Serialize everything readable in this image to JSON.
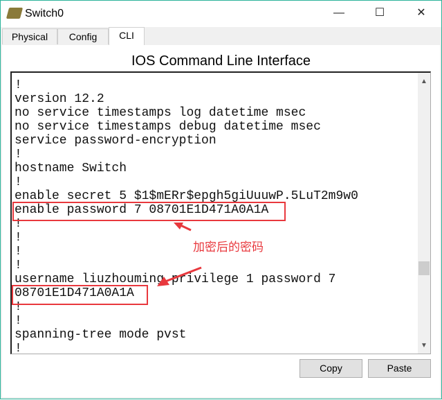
{
  "window": {
    "title": "Switch0",
    "minimize": "—",
    "maximize": "☐",
    "close": "✕",
    "icon": "switch-icon"
  },
  "tabs": [
    {
      "label": "Physical"
    },
    {
      "label": "Config"
    },
    {
      "label": "CLI",
      "active": true
    }
  ],
  "heading": "IOS Command Line Interface",
  "terminal": {
    "lines": [
      "!",
      "version 12.2",
      "no service timestamps log datetime msec",
      "no service timestamps debug datetime msec",
      "service password-encryption",
      "!",
      "hostname Switch",
      "!",
      "enable secret 5 $1$mERr$epgh5giUuuwP.5LuT2m9w0",
      "enable password 7 08701E1D471A0A1A",
      "!",
      "!",
      "!",
      "!",
      "username liuzhouming privilege 1 password 7",
      "08701E1D471A0A1A",
      "!",
      "!",
      "spanning-tree mode pvst",
      "!"
    ]
  },
  "annotation": {
    "text": "加密后的密码",
    "color": "#e8383d"
  },
  "buttons": {
    "copy": "Copy",
    "paste": "Paste"
  }
}
